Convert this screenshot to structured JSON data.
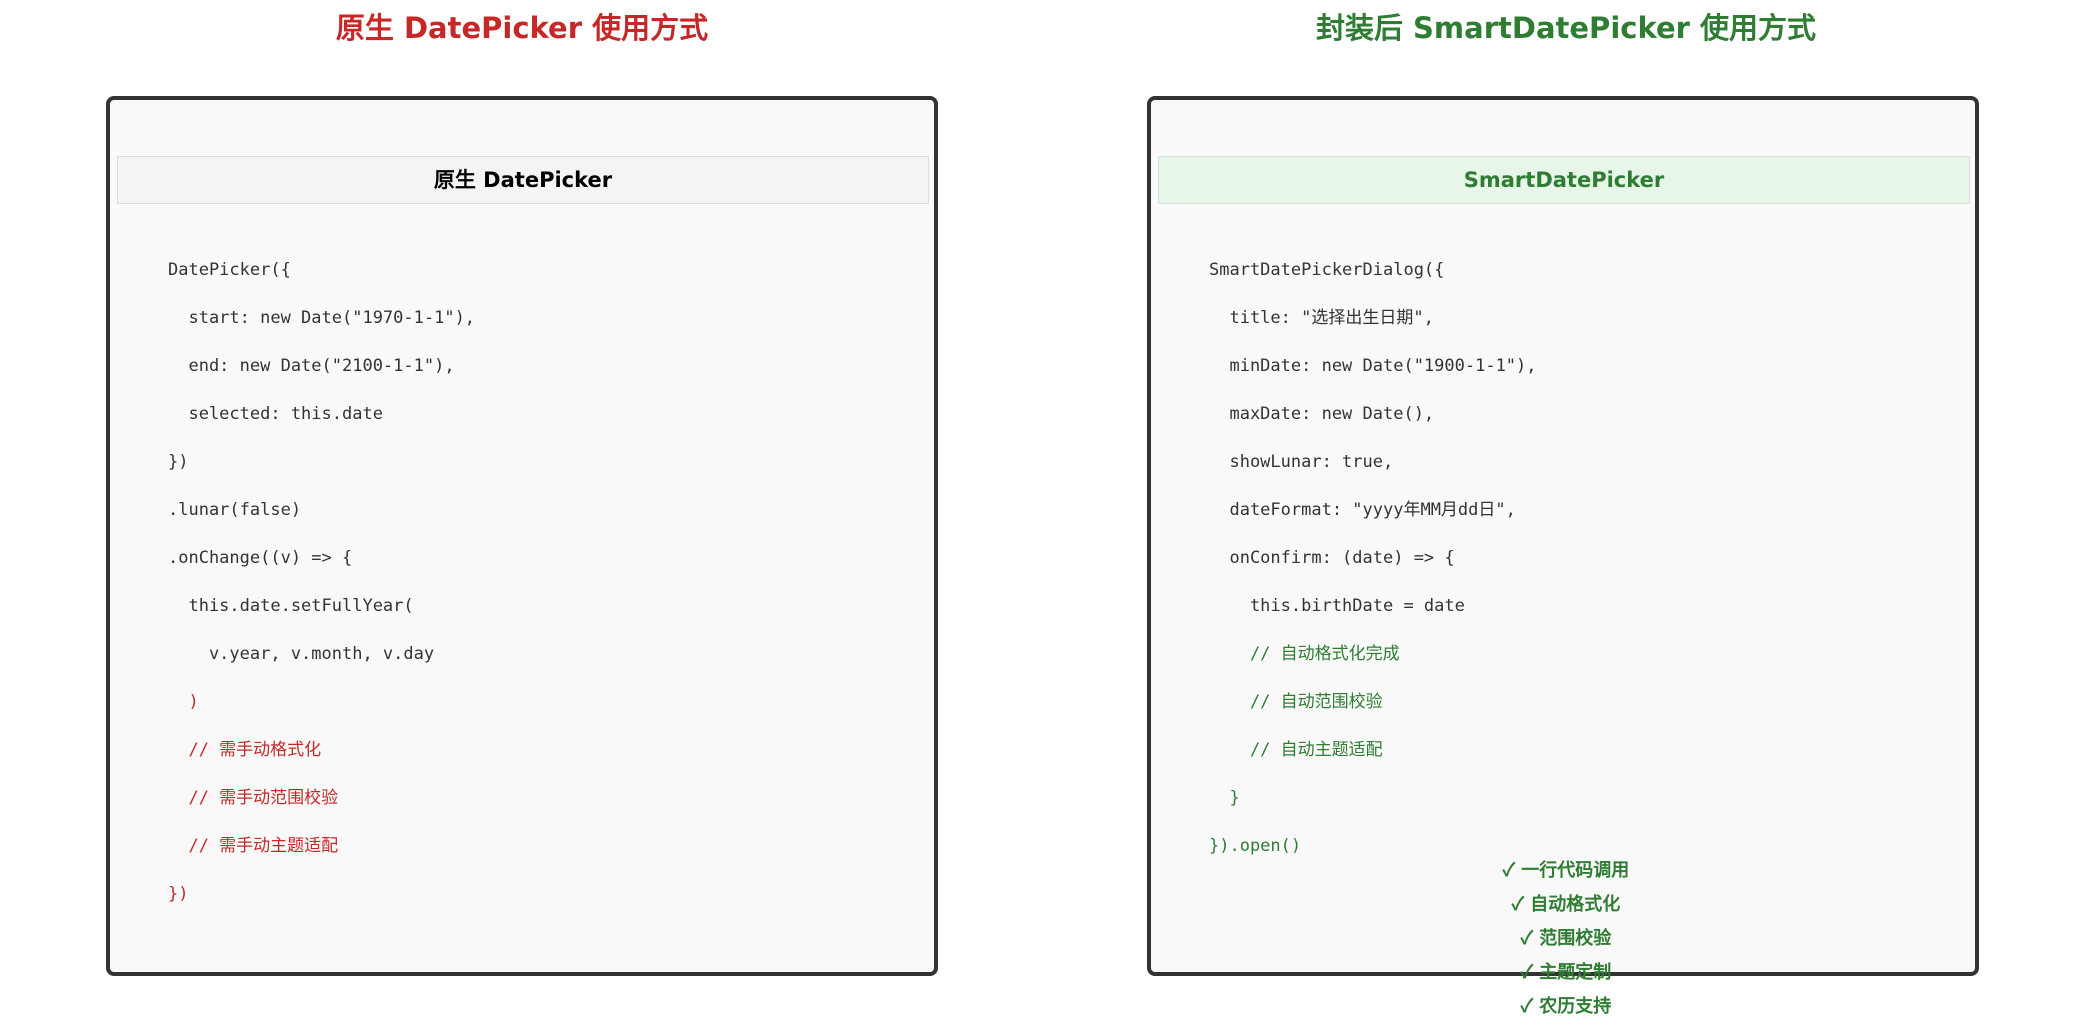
{
  "titles": {
    "left": "原生 DatePicker 使用方式",
    "right": "封装后 SmartDatePicker 使用方式"
  },
  "left_panel": {
    "header": "原生 DatePicker",
    "code_lines": [
      {
        "text": "DatePicker({",
        "tone": "normal"
      },
      {
        "text": "  start: new Date(\"1970-1-1\"),",
        "tone": "normal"
      },
      {
        "text": "  end: new Date(\"2100-1-1\"),",
        "tone": "normal"
      },
      {
        "text": "  selected: this.date",
        "tone": "normal"
      },
      {
        "text": "})",
        "tone": "normal"
      },
      {
        "text": ".lunar(false)",
        "tone": "normal"
      },
      {
        "text": ".onChange((v) => {",
        "tone": "normal"
      },
      {
        "text": "  this.date.setFullYear(",
        "tone": "normal"
      },
      {
        "text": "    v.year, v.month, v.day",
        "tone": "normal"
      },
      {
        "text": "  )",
        "tone": "red"
      },
      {
        "text": "  // 需手动格式化",
        "tone": "red"
      },
      {
        "text": "  // 需手动范围校验",
        "tone": "red"
      },
      {
        "text": "  // 需手动主题适配",
        "tone": "red"
      },
      {
        "text": "})",
        "tone": "red"
      }
    ]
  },
  "right_panel": {
    "header": "SmartDatePicker",
    "code_lines": [
      {
        "text": "SmartDatePickerDialog({",
        "tone": "normal"
      },
      {
        "text": "  title: \"选择出生日期\",",
        "tone": "normal"
      },
      {
        "text": "  minDate: new Date(\"1900-1-1\"),",
        "tone": "normal"
      },
      {
        "text": "  maxDate: new Date(),",
        "tone": "normal"
      },
      {
        "text": "  showLunar: true,",
        "tone": "normal"
      },
      {
        "text": "  dateFormat: \"yyyy年MM月dd日\",",
        "tone": "normal"
      },
      {
        "text": "  onConfirm: (date) => {",
        "tone": "normal"
      },
      {
        "text": "    this.birthDate = date",
        "tone": "normal"
      },
      {
        "text": "    // 自动格式化完成",
        "tone": "green"
      },
      {
        "text": "    // 自动范围校验",
        "tone": "green"
      },
      {
        "text": "    // 自动主题适配",
        "tone": "green"
      },
      {
        "text": "  }",
        "tone": "green"
      },
      {
        "text": "}).open()",
        "tone": "green"
      }
    ]
  },
  "features": [
    "✓ 一行代码调用",
    "✓ 自动格式化",
    "✓ 范围校验",
    "✓ 主题定制",
    "✓ 农历支持"
  ],
  "colors": {
    "red": "#c62828",
    "green": "#2e7d32",
    "border": "#333333",
    "panel_bg": "#f9f9f9"
  }
}
